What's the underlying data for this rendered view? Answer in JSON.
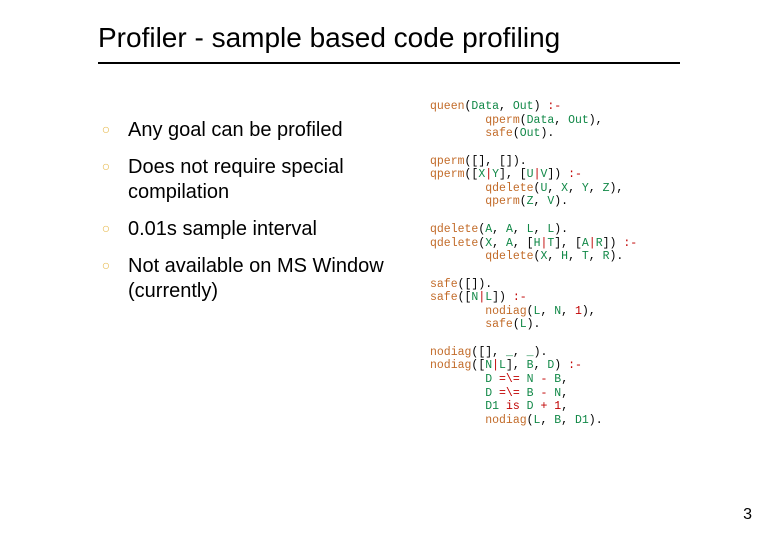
{
  "title": "Profiler - sample based code profiling",
  "bullets": [
    "Any goal can be profiled",
    "Does not require special compilation",
    "0.01s sample interval",
    "Not available on MS Window (currently)"
  ],
  "code_blocks": [
    {
      "lines": [
        [
          {
            "t": "pred",
            "v": "queen"
          },
          {
            "t": "punct",
            "v": "("
          },
          {
            "t": "var",
            "v": "Data"
          },
          {
            "t": "punct",
            "v": ", "
          },
          {
            "t": "var",
            "v": "Out"
          },
          {
            "t": "punct",
            "v": ") "
          },
          {
            "t": "op",
            "v": ":-"
          }
        ],
        [
          {
            "t": "punct",
            "v": "        "
          },
          {
            "t": "pred",
            "v": "qperm"
          },
          {
            "t": "punct",
            "v": "("
          },
          {
            "t": "var",
            "v": "Data"
          },
          {
            "t": "punct",
            "v": ", "
          },
          {
            "t": "var",
            "v": "Out"
          },
          {
            "t": "punct",
            "v": "),"
          }
        ],
        [
          {
            "t": "punct",
            "v": "        "
          },
          {
            "t": "pred",
            "v": "safe"
          },
          {
            "t": "punct",
            "v": "("
          },
          {
            "t": "var",
            "v": "Out"
          },
          {
            "t": "punct",
            "v": ")."
          }
        ]
      ]
    },
    {
      "lines": [
        [
          {
            "t": "pred",
            "v": "qperm"
          },
          {
            "t": "punct",
            "v": "([], [])."
          }
        ],
        [
          {
            "t": "pred",
            "v": "qperm"
          },
          {
            "t": "punct",
            "v": "(["
          },
          {
            "t": "var",
            "v": "X"
          },
          {
            "t": "op",
            "v": "|"
          },
          {
            "t": "var",
            "v": "Y"
          },
          {
            "t": "punct",
            "v": "], ["
          },
          {
            "t": "var",
            "v": "U"
          },
          {
            "t": "op",
            "v": "|"
          },
          {
            "t": "var",
            "v": "V"
          },
          {
            "t": "punct",
            "v": "]) "
          },
          {
            "t": "op",
            "v": ":-"
          }
        ],
        [
          {
            "t": "punct",
            "v": "        "
          },
          {
            "t": "pred",
            "v": "qdelete"
          },
          {
            "t": "punct",
            "v": "("
          },
          {
            "t": "var",
            "v": "U"
          },
          {
            "t": "punct",
            "v": ", "
          },
          {
            "t": "var",
            "v": "X"
          },
          {
            "t": "punct",
            "v": ", "
          },
          {
            "t": "var",
            "v": "Y"
          },
          {
            "t": "punct",
            "v": ", "
          },
          {
            "t": "var",
            "v": "Z"
          },
          {
            "t": "punct",
            "v": "),"
          }
        ],
        [
          {
            "t": "punct",
            "v": "        "
          },
          {
            "t": "pred",
            "v": "qperm"
          },
          {
            "t": "punct",
            "v": "("
          },
          {
            "t": "var",
            "v": "Z"
          },
          {
            "t": "punct",
            "v": ", "
          },
          {
            "t": "var",
            "v": "V"
          },
          {
            "t": "punct",
            "v": ")."
          }
        ]
      ]
    },
    {
      "lines": [
        [
          {
            "t": "pred",
            "v": "qdelete"
          },
          {
            "t": "punct",
            "v": "("
          },
          {
            "t": "var",
            "v": "A"
          },
          {
            "t": "punct",
            "v": ", "
          },
          {
            "t": "var",
            "v": "A"
          },
          {
            "t": "punct",
            "v": ", "
          },
          {
            "t": "var",
            "v": "L"
          },
          {
            "t": "punct",
            "v": ", "
          },
          {
            "t": "var",
            "v": "L"
          },
          {
            "t": "punct",
            "v": ")."
          }
        ],
        [
          {
            "t": "pred",
            "v": "qdelete"
          },
          {
            "t": "punct",
            "v": "("
          },
          {
            "t": "var",
            "v": "X"
          },
          {
            "t": "punct",
            "v": ", "
          },
          {
            "t": "var",
            "v": "A"
          },
          {
            "t": "punct",
            "v": ", ["
          },
          {
            "t": "var",
            "v": "H"
          },
          {
            "t": "op",
            "v": "|"
          },
          {
            "t": "var",
            "v": "T"
          },
          {
            "t": "punct",
            "v": "], ["
          },
          {
            "t": "var",
            "v": "A"
          },
          {
            "t": "op",
            "v": "|"
          },
          {
            "t": "var",
            "v": "R"
          },
          {
            "t": "punct",
            "v": "]) "
          },
          {
            "t": "op",
            "v": ":-"
          }
        ],
        [
          {
            "t": "punct",
            "v": "        "
          },
          {
            "t": "pred",
            "v": "qdelete"
          },
          {
            "t": "punct",
            "v": "("
          },
          {
            "t": "var",
            "v": "X"
          },
          {
            "t": "punct",
            "v": ", "
          },
          {
            "t": "var",
            "v": "H"
          },
          {
            "t": "punct",
            "v": ", "
          },
          {
            "t": "var",
            "v": "T"
          },
          {
            "t": "punct",
            "v": ", "
          },
          {
            "t": "var",
            "v": "R"
          },
          {
            "t": "punct",
            "v": ")."
          }
        ]
      ]
    },
    {
      "lines": [
        [
          {
            "t": "pred",
            "v": "safe"
          },
          {
            "t": "punct",
            "v": "([])."
          }
        ],
        [
          {
            "t": "pred",
            "v": "safe"
          },
          {
            "t": "punct",
            "v": "(["
          },
          {
            "t": "var",
            "v": "N"
          },
          {
            "t": "op",
            "v": "|"
          },
          {
            "t": "var",
            "v": "L"
          },
          {
            "t": "punct",
            "v": "]) "
          },
          {
            "t": "op",
            "v": ":-"
          }
        ],
        [
          {
            "t": "punct",
            "v": "        "
          },
          {
            "t": "pred",
            "v": "nodiag"
          },
          {
            "t": "punct",
            "v": "("
          },
          {
            "t": "var",
            "v": "L"
          },
          {
            "t": "punct",
            "v": ", "
          },
          {
            "t": "var",
            "v": "N"
          },
          {
            "t": "punct",
            "v": ", "
          },
          {
            "t": "num",
            "v": "1"
          },
          {
            "t": "punct",
            "v": "),"
          }
        ],
        [
          {
            "t": "punct",
            "v": "        "
          },
          {
            "t": "pred",
            "v": "safe"
          },
          {
            "t": "punct",
            "v": "("
          },
          {
            "t": "var",
            "v": "L"
          },
          {
            "t": "punct",
            "v": ")."
          }
        ]
      ]
    },
    {
      "lines": [
        [
          {
            "t": "pred",
            "v": "nodiag"
          },
          {
            "t": "punct",
            "v": "([], "
          },
          {
            "t": "var",
            "v": "_"
          },
          {
            "t": "punct",
            "v": ", "
          },
          {
            "t": "var",
            "v": "_"
          },
          {
            "t": "punct",
            "v": ")."
          }
        ],
        [
          {
            "t": "pred",
            "v": "nodiag"
          },
          {
            "t": "punct",
            "v": "(["
          },
          {
            "t": "var",
            "v": "N"
          },
          {
            "t": "op",
            "v": "|"
          },
          {
            "t": "var",
            "v": "L"
          },
          {
            "t": "punct",
            "v": "], "
          },
          {
            "t": "var",
            "v": "B"
          },
          {
            "t": "punct",
            "v": ", "
          },
          {
            "t": "var",
            "v": "D"
          },
          {
            "t": "punct",
            "v": ") "
          },
          {
            "t": "op",
            "v": ":-"
          }
        ],
        [
          {
            "t": "punct",
            "v": "        "
          },
          {
            "t": "var",
            "v": "D"
          },
          {
            "t": "punct",
            "v": " "
          },
          {
            "t": "op",
            "v": "=\\="
          },
          {
            "t": "punct",
            "v": " "
          },
          {
            "t": "var",
            "v": "N"
          },
          {
            "t": "punct",
            "v": " "
          },
          {
            "t": "op",
            "v": "-"
          },
          {
            "t": "punct",
            "v": " "
          },
          {
            "t": "var",
            "v": "B"
          },
          {
            "t": "punct",
            "v": ","
          }
        ],
        [
          {
            "t": "punct",
            "v": "        "
          },
          {
            "t": "var",
            "v": "D"
          },
          {
            "t": "punct",
            "v": " "
          },
          {
            "t": "op",
            "v": "=\\="
          },
          {
            "t": "punct",
            "v": " "
          },
          {
            "t": "var",
            "v": "B"
          },
          {
            "t": "punct",
            "v": " "
          },
          {
            "t": "op",
            "v": "-"
          },
          {
            "t": "punct",
            "v": " "
          },
          {
            "t": "var",
            "v": "N"
          },
          {
            "t": "punct",
            "v": ","
          }
        ],
        [
          {
            "t": "punct",
            "v": "        "
          },
          {
            "t": "var",
            "v": "D1"
          },
          {
            "t": "punct",
            "v": " "
          },
          {
            "t": "op",
            "v": "is"
          },
          {
            "t": "punct",
            "v": " "
          },
          {
            "t": "var",
            "v": "D"
          },
          {
            "t": "punct",
            "v": " "
          },
          {
            "t": "op",
            "v": "+"
          },
          {
            "t": "punct",
            "v": " "
          },
          {
            "t": "num",
            "v": "1"
          },
          {
            "t": "punct",
            "v": ","
          }
        ],
        [
          {
            "t": "punct",
            "v": "        "
          },
          {
            "t": "pred",
            "v": "nodiag"
          },
          {
            "t": "punct",
            "v": "("
          },
          {
            "t": "var",
            "v": "L"
          },
          {
            "t": "punct",
            "v": ", "
          },
          {
            "t": "var",
            "v": "B"
          },
          {
            "t": "punct",
            "v": ", "
          },
          {
            "t": "var",
            "v": "D1"
          },
          {
            "t": "punct",
            "v": ")."
          }
        ]
      ]
    }
  ],
  "page_number": "3",
  "bullet_glyph": "○"
}
